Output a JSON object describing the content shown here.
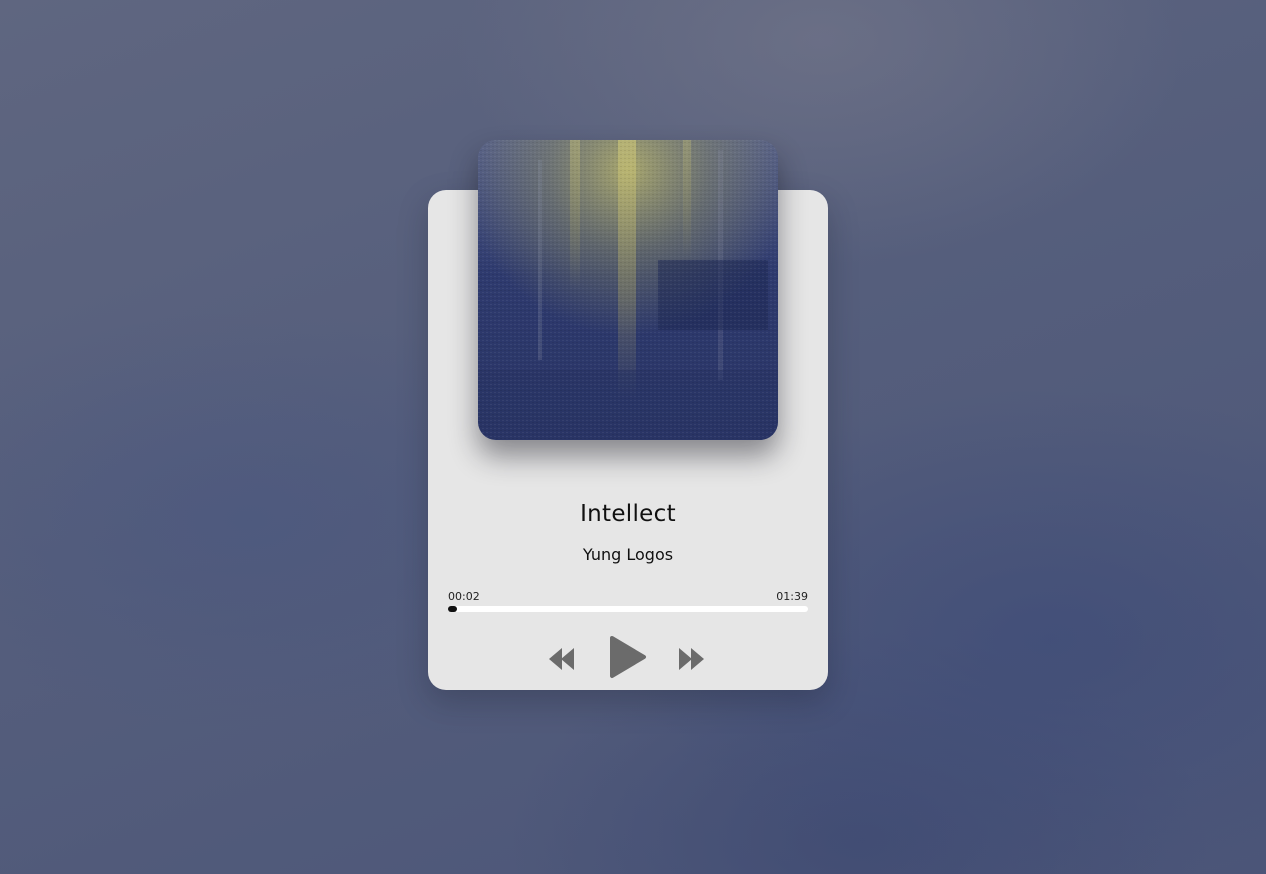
{
  "track": {
    "title": "Intellect",
    "artist": "Yung Logos"
  },
  "playback": {
    "current_time": "00:02",
    "total_time": "01:39",
    "progress_fraction": 0.02
  },
  "controls": {
    "prev_icon": "rewind-icon",
    "play_icon": "play-icon",
    "next_icon": "fast-forward-icon"
  },
  "colors": {
    "card": "#e6e6e6",
    "progress_track": "#ffffff",
    "progress_fill": "#111111",
    "icon": "#6b6b6b"
  }
}
